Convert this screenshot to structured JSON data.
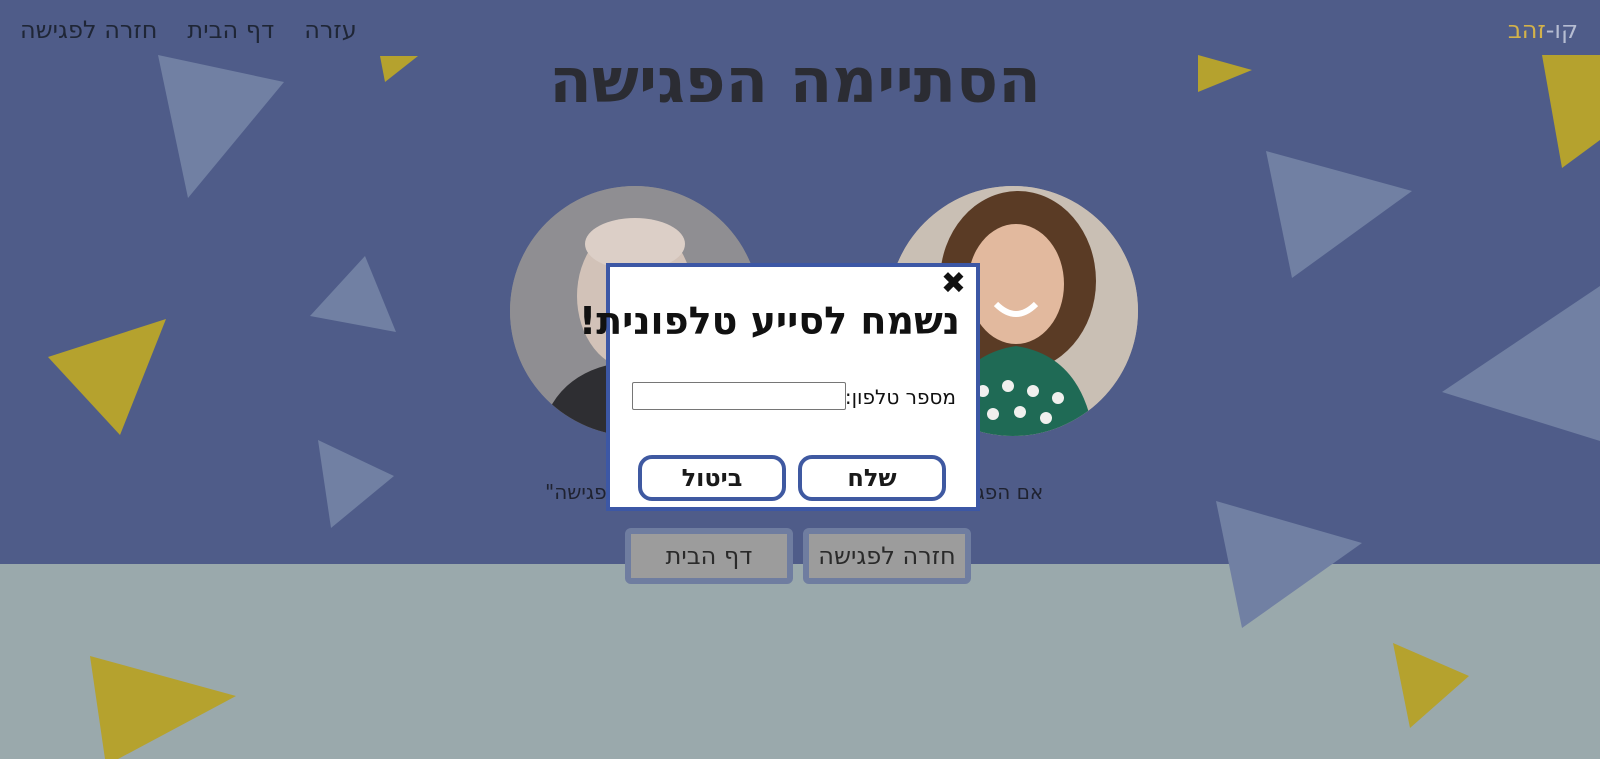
{
  "brand": {
    "part1": "קו-",
    "part2": "זהב"
  },
  "nav": {
    "items": [
      {
        "label": "חזרה לפגישה"
      },
      {
        "label": "דף הבית"
      },
      {
        "label": "עזרה"
      }
    ]
  },
  "main": {
    "title": "הסתיימה הפגישה",
    "caption_right": "אם הפגי",
    "caption_left": "פגישה\"",
    "buttons": {
      "back_to_meeting": "חזרה לפגישה",
      "home": "דף הבית"
    }
  },
  "modal": {
    "close_glyph": "✖",
    "title": "נשמח לסייע טלפונית!",
    "phone_label": "מספר טלפון:",
    "phone_value": "",
    "send_label": "שלח",
    "cancel_label": "ביטול"
  },
  "colors": {
    "top_background": "#4f5c89",
    "bottom_background": "#9aa9ac",
    "accent_yellow": "#b5a22e",
    "accent_blue_triangle": "#7180a3",
    "modal_border": "#3c57a5"
  },
  "icons": {
    "close": "close-icon"
  }
}
